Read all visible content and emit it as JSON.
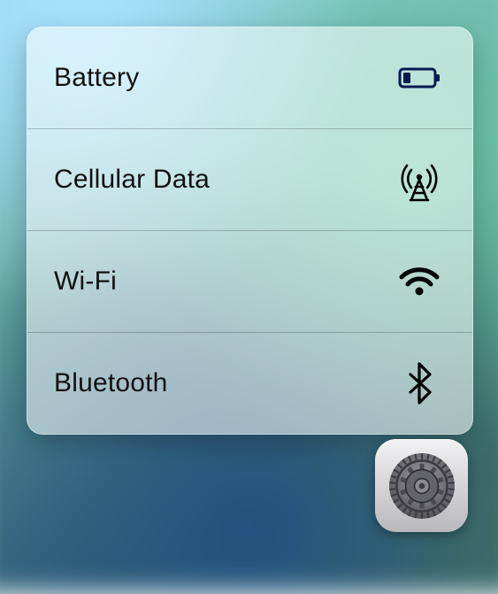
{
  "menu": {
    "items": [
      {
        "label": "Battery",
        "icon": "battery-low-icon"
      },
      {
        "label": "Cellular Data",
        "icon": "cell-tower-icon"
      },
      {
        "label": "Wi-Fi",
        "icon": "wifi-icon"
      },
      {
        "label": "Bluetooth",
        "icon": "bluetooth-icon"
      }
    ]
  },
  "app": {
    "name": "Settings",
    "icon": "settings-gear-icon"
  }
}
